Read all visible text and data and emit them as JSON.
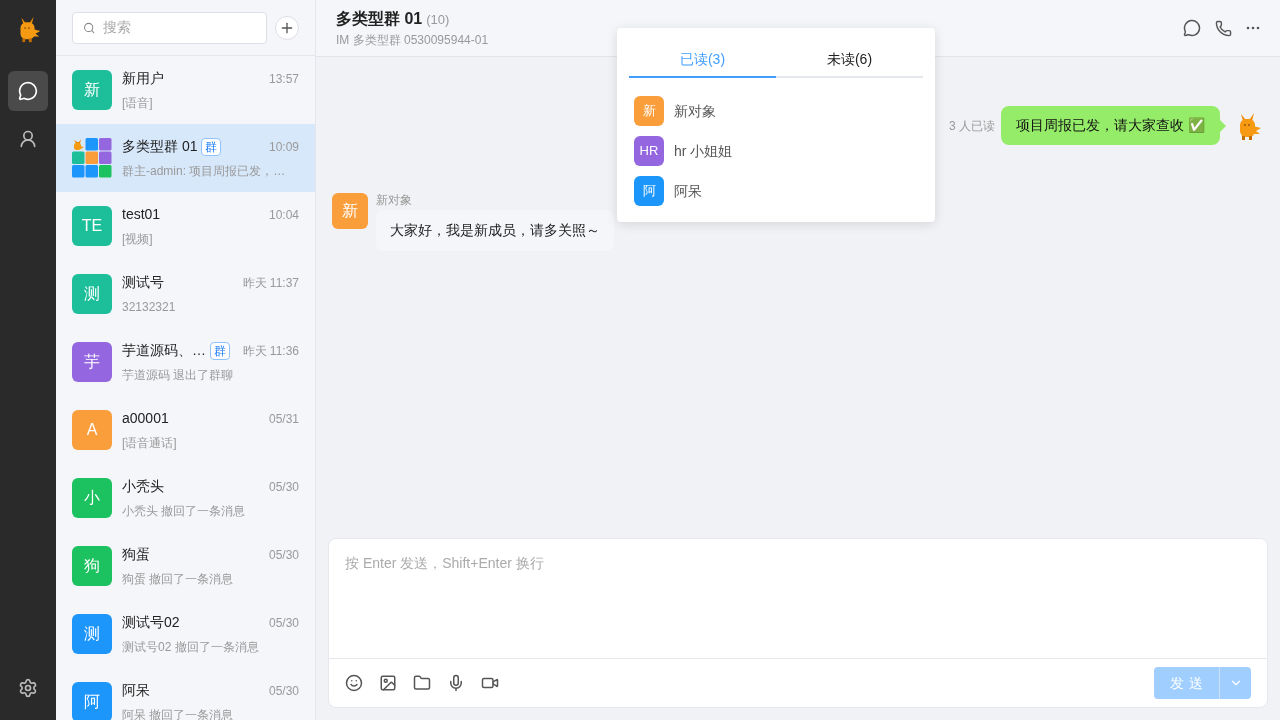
{
  "rail": {
    "items": [
      {
        "kind": "chat",
        "selected": true
      },
      {
        "kind": "contacts",
        "selected": false
      }
    ]
  },
  "search": {
    "placeholder": "搜索"
  },
  "conversations": [
    {
      "avatar": "新",
      "color": "#1dbf9a",
      "kind": "text",
      "name": "新用户",
      "time": "13:57",
      "preview": "[语音]",
      "selected": false
    },
    {
      "kind": "group",
      "name": "多类型群 01",
      "tag": "群",
      "time": "10:09",
      "preview": "群主-admin: 项目周报已发，…",
      "selected": true
    },
    {
      "avatar": "TE",
      "color": "#1dbf9a",
      "kind": "text",
      "name": "test01",
      "time": "10:04",
      "preview": "[视频]",
      "selected": false
    },
    {
      "avatar": "测",
      "color": "#1dbf9a",
      "kind": "text",
      "name": "测试号",
      "time": "昨天 11:37",
      "preview": "32132321",
      "selected": false
    },
    {
      "avatar": "芋",
      "color": "#9466e0",
      "kind": "text",
      "name": "芋道源码、…",
      "tag": "群",
      "time": "昨天 11:36",
      "preview": "芋道源码 退出了群聊",
      "selected": false
    },
    {
      "avatar": "A",
      "color": "#fa9e3c",
      "kind": "text",
      "name": "a00001",
      "time": "05/31",
      "preview": "[语音通话]",
      "selected": false
    },
    {
      "avatar": "小",
      "color": "#1cc160",
      "kind": "text",
      "name": "小秃头",
      "time": "05/30",
      "preview": "小秃头 撤回了一条消息",
      "selected": false
    },
    {
      "avatar": "狗",
      "color": "#1cc160",
      "kind": "text",
      "name": "狗蛋",
      "time": "05/30",
      "preview": "狗蛋 撤回了一条消息",
      "selected": false
    },
    {
      "avatar": "测",
      "color": "#1c96fb",
      "kind": "text",
      "name": "测试号02",
      "time": "05/30",
      "preview": "测试号02 撤回了一条消息",
      "selected": false
    },
    {
      "avatar": "阿",
      "color": "#1c96fb",
      "kind": "text",
      "name": "阿呆",
      "time": "05/30",
      "preview": "阿呆 撤回了一条消息",
      "selected": false
    }
  ],
  "header": {
    "title": "多类型群 01",
    "count": "(10)",
    "subtitle": "IM 多类型群 0530095944-01"
  },
  "messages": [
    {
      "kind": "outgoing",
      "text": "项目周报已发，请大家查收 ✅",
      "read_status": "3 人已读"
    },
    {
      "kind": "incoming",
      "avatar": "新",
      "color": "#fa9e3c",
      "sender": "新对象",
      "text": "大家好，我是新成员，请多关照～"
    }
  ],
  "read_popover": {
    "tabs": [
      {
        "label": "已读(3)",
        "selected": true
      },
      {
        "label": "未读(6)",
        "selected": false
      }
    ],
    "members": [
      {
        "avatar": "新",
        "color": "#fa9e3c",
        "name": "新对象"
      },
      {
        "avatar": "HR",
        "color": "#9466e0",
        "name": "hr 小姐姐"
      },
      {
        "avatar": "阿",
        "color": "#1c96fb",
        "name": "阿呆"
      }
    ]
  },
  "composer": {
    "placeholder": "按 Enter 发送，Shift+Enter 换行",
    "send_label": "发 送",
    "send_disabled": true
  }
}
